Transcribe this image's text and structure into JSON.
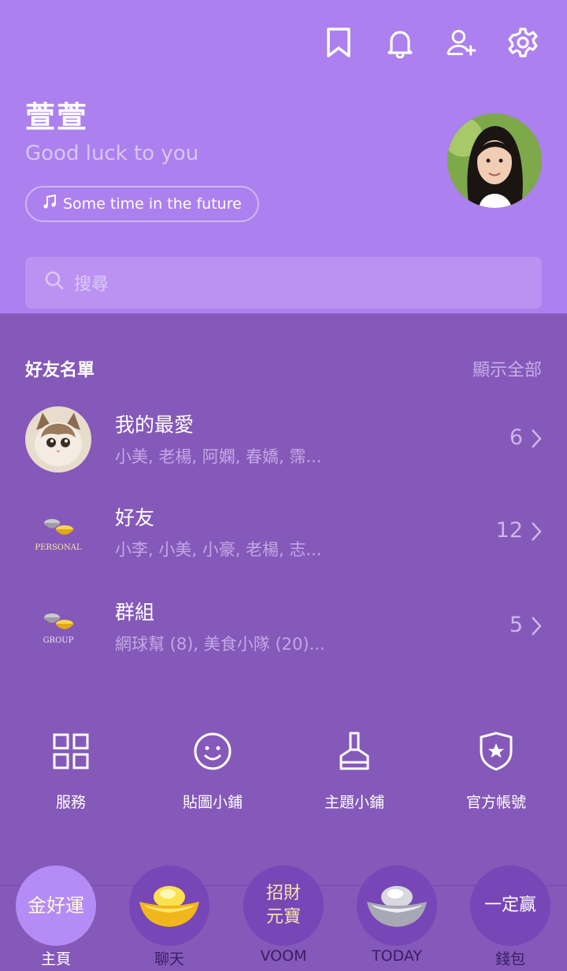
{
  "profile": {
    "name": "萱萱",
    "status": "Good luck to you",
    "music": "Some time in the future"
  },
  "search": {
    "placeholder": "搜尋"
  },
  "friends_section": {
    "title": "好友名單",
    "show_all": "顯示全部",
    "rows": [
      {
        "title": "我的最愛",
        "subtitle": "小美, 老楊, 阿嫻, 春嬌, 霈...",
        "count": "6"
      },
      {
        "title": "好友",
        "subtitle": "小李, 小美, 小豪, 老楊, 志...",
        "count": "12",
        "badge": "PERSONAL"
      },
      {
        "title": "群組",
        "subtitle": "網球幫 (8), 美食小隊 (20)...",
        "count": "5",
        "badge": "GROUP"
      }
    ]
  },
  "services": [
    {
      "label": "服務",
      "icon": "grid-icon"
    },
    {
      "label": "貼圖小鋪",
      "icon": "smiley-icon"
    },
    {
      "label": "主題小鋪",
      "icon": "brush-icon"
    },
    {
      "label": "官方帳號",
      "icon": "shield-star-icon"
    }
  ],
  "tabs": [
    {
      "label": "主頁",
      "emblem": "金好運",
      "active": true
    },
    {
      "label": "聊天"
    },
    {
      "label": "VOOM",
      "emblem_line1": "招財",
      "emblem_line2": "元寶"
    },
    {
      "label": "TODAY"
    },
    {
      "label": "錢包",
      "emblem": "一定赢"
    }
  ],
  "colors": {
    "header_bg": "#ac80ee",
    "body_bg": "#8559b9",
    "tab_active": "#b58cf5"
  }
}
